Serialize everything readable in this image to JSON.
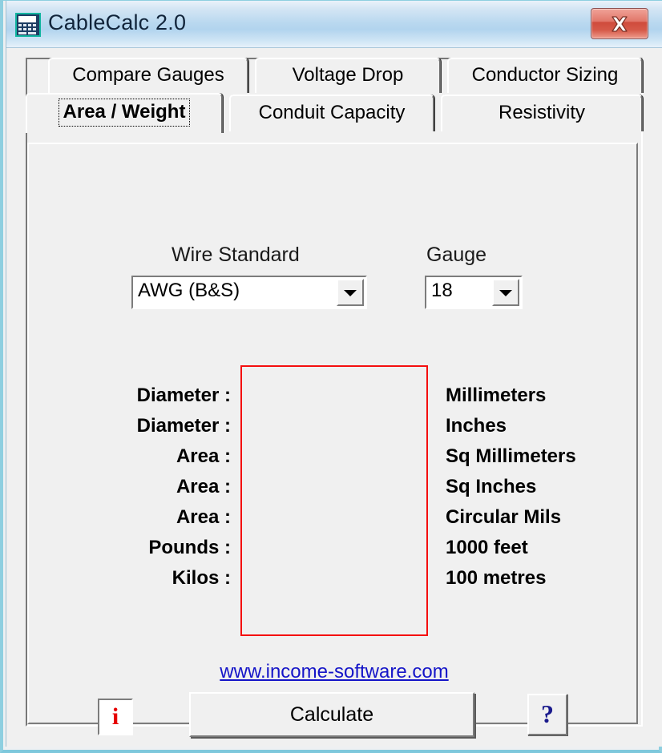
{
  "window": {
    "title": "CableCalc 2.0",
    "app_icon": "calculator-icon",
    "close_label": "×",
    "close_icon": "close-icon"
  },
  "tabs": {
    "row1": [
      {
        "label": "Compare Gauges",
        "active": false
      },
      {
        "label": "Voltage Drop",
        "active": false
      },
      {
        "label": "Conductor Sizing",
        "active": false
      }
    ],
    "row2": [
      {
        "label": "Area / Weight",
        "active": true
      },
      {
        "label": "Conduit Capacity",
        "active": false
      },
      {
        "label": "Resistivity",
        "active": false
      }
    ]
  },
  "form": {
    "wire_standard_label": "Wire Standard",
    "wire_standard_value": "AWG (B&S)",
    "gauge_label": "Gauge",
    "gauge_value": "18"
  },
  "results": {
    "rows": [
      {
        "label": "Diameter :",
        "value": "",
        "unit": "Millimeters"
      },
      {
        "label": "Diameter :",
        "value": "",
        "unit": "Inches"
      },
      {
        "label": "Area :",
        "value": "",
        "unit": "Sq Millimeters"
      },
      {
        "label": "Area :",
        "value": "",
        "unit": "Sq Inches"
      },
      {
        "label": "Area :",
        "value": "",
        "unit": "Circular Mils"
      },
      {
        "label": "Pounds :",
        "value": "",
        "unit": "1000 feet"
      },
      {
        "label": "Kilos :",
        "value": "",
        "unit": "100 metres"
      }
    ],
    "box_border_color": "#f50f0f"
  },
  "footer": {
    "website": "www.income-software.com",
    "info_label": "i",
    "info_icon": "info-icon",
    "calculate_label": "Calculate",
    "help_label": "?",
    "help_icon": "help-icon"
  },
  "colors": {
    "titlebar_accent": "#b2d4ee",
    "close_button": "#cf4b3c",
    "link": "#1515c8",
    "dialog_face": "#f0f0f0",
    "window_border": "#7ec8dc"
  }
}
